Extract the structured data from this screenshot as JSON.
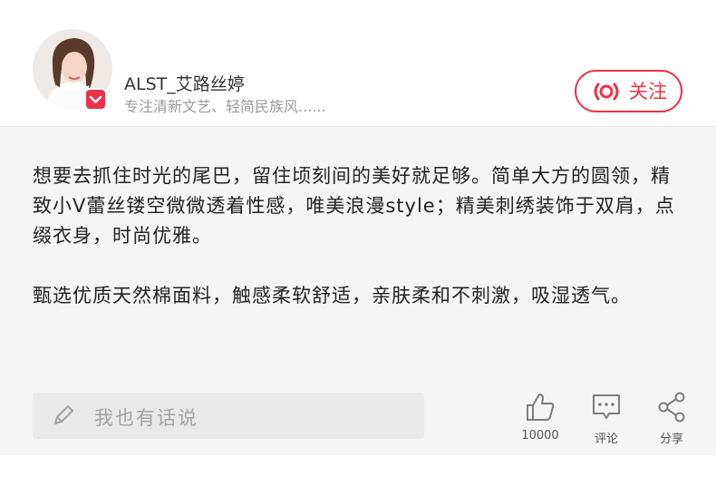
{
  "header": {
    "username": "ALST_艾路丝婷",
    "subtitle": "专注清新文艺、轻简民族风......",
    "follow_label": "关注"
  },
  "content": {
    "paragraphs": [
      "想要去抓住时光的尾巴，留住顷刻间的美好就足够。简单大方的圆领，精致小V蕾丝镂空微微透着性感，唯美浪漫style；精美刺绣装饰于双肩，点缀衣身，时尚优雅。",
      "甄选优质天然棉面料，触感柔软舒适，亲肤柔和不刺激，吸湿透气。"
    ]
  },
  "footer": {
    "comment_placeholder": "我也有话说",
    "like_count": "10000",
    "comment_label": "评论",
    "share_label": "分享"
  },
  "colors": {
    "accent": "#e8334a",
    "background": "#f5f5f5",
    "muted_text": "#9a9a9a"
  },
  "icons": {
    "follow": "live-broadcast-icon",
    "comment_input": "pencil-icon",
    "like": "thumbs-up-icon",
    "comment": "comment-icon",
    "share": "share-icon",
    "badge": "chevron-down-icon"
  }
}
